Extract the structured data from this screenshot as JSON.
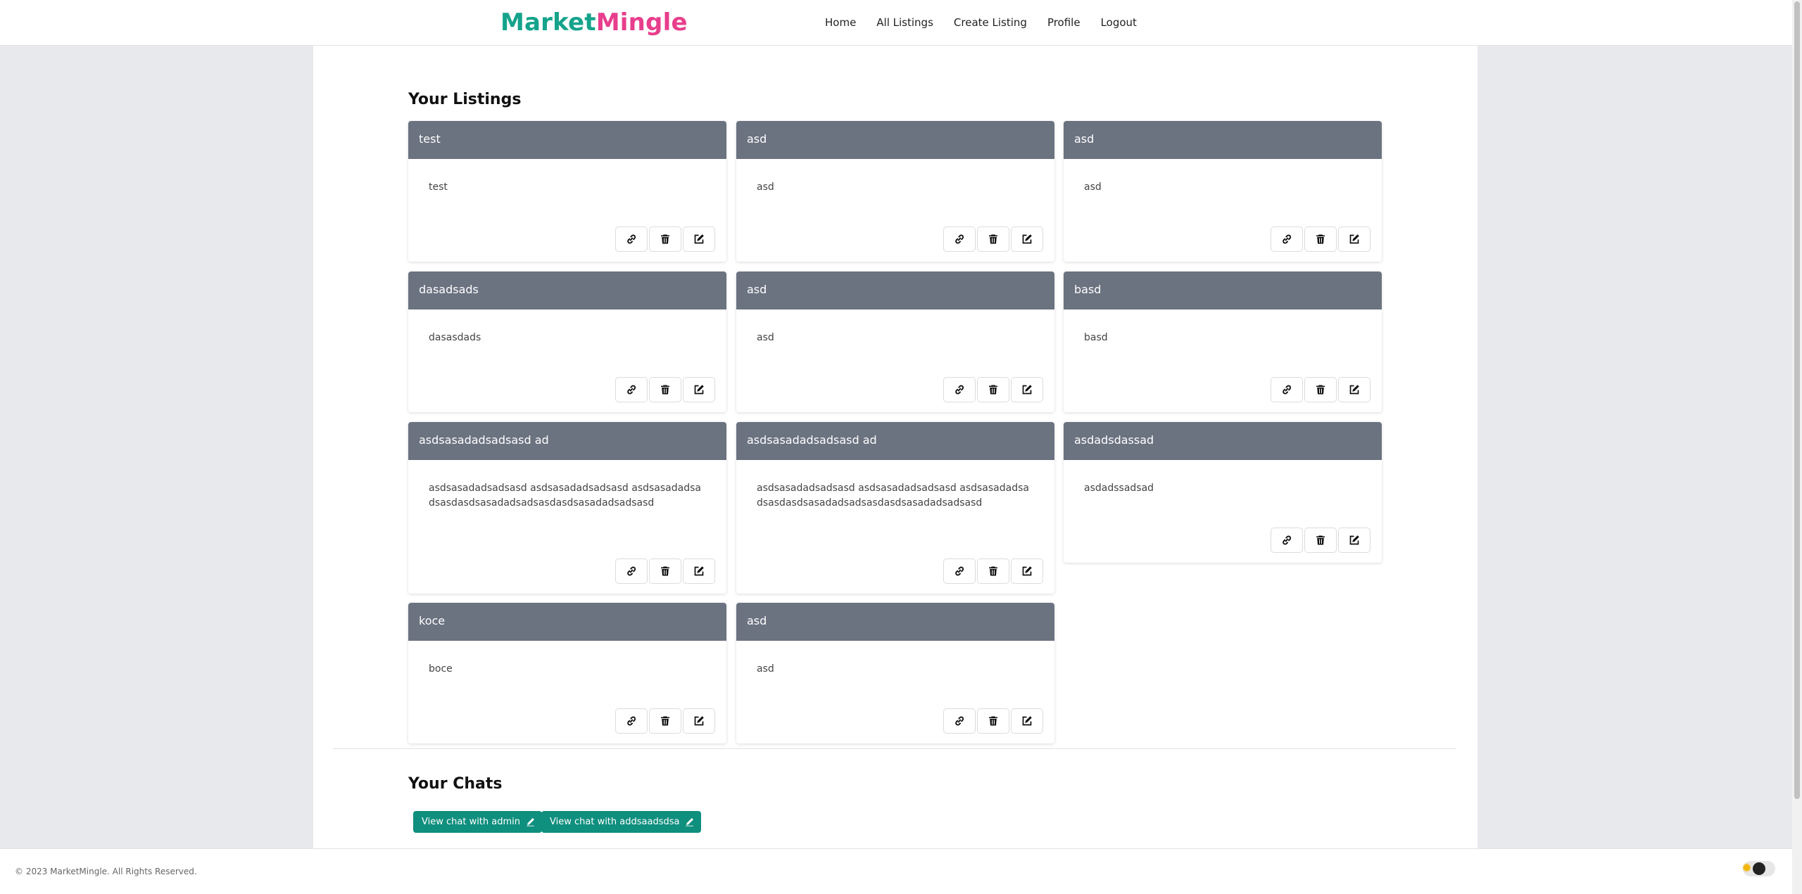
{
  "brand": {
    "part1": "Market",
    "part2": "Mingle"
  },
  "nav": [
    "Home",
    "All Listings",
    "Create Listing",
    "Profile",
    "Logout"
  ],
  "listings_title": "Your Listings",
  "listings": [
    {
      "title": "test",
      "description": "test"
    },
    {
      "title": "asd",
      "description": "asd"
    },
    {
      "title": "asd",
      "description": "asd"
    },
    {
      "title": "dasadsads",
      "description": "dasasdads"
    },
    {
      "title": "asd",
      "description": "asd"
    },
    {
      "title": "basd",
      "description": "basd"
    },
    {
      "title": "asdsasadadsadsasd ad",
      "description": "asdsasadadsadsasd asdsasadadsadsasd asdsasadadsadsasdasdsasadadsadsasdasdsasadadsadsasd"
    },
    {
      "title": "asdsasadadsadsasd ad",
      "description": "asdsasadadsadsasd asdsasadadsadsasd asdsasadadsadsasdasdsasadadsadsasdasdsasadadsadsasd"
    },
    {
      "title": "asdadsdassad",
      "description": "asdadssadsad"
    },
    {
      "title": "koce",
      "description": "boce"
    },
    {
      "title": "asd",
      "description": "asd"
    }
  ],
  "chats_title": "Your Chats",
  "chats": [
    "View chat with admin",
    "View chat with addsaadsdsa"
  ],
  "footer": "© 2023 MarketMingle. All Rights Reserved.",
  "icons": {
    "link": "link-icon",
    "delete": "trash-icon",
    "edit": "edit-icon",
    "chat": "pencil-icon",
    "theme": "sun-moon-toggle"
  },
  "colors": {
    "brand_teal": "#14a38b",
    "brand_pink": "#e83e8c",
    "card_header": "#6b7280",
    "chat_button": "#0f8f7e"
  }
}
